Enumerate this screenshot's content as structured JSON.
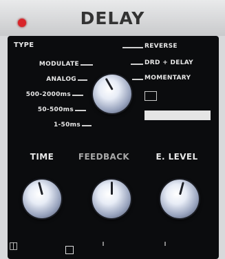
{
  "header": {
    "title": "DELAY"
  },
  "type_section": {
    "heading": "TYPE",
    "left_options": [
      "MODULATE",
      "ANALOG",
      "500-2000ms",
      "50-500ms",
      "1-50ms"
    ],
    "right_options": [
      "REVERSE",
      "DRD + DELAY",
      "MOMENTARY"
    ],
    "buttons": [
      "",
      ""
    ]
  },
  "params": [
    {
      "label": "TIME",
      "value": 0.45
    },
    {
      "label": "FEEDBACK",
      "value": 0.5
    },
    {
      "label": "E. LEVEL",
      "value": 0.55
    }
  ],
  "bottom": {
    "left_icon": "input-icon",
    "mid_icon": "jack-icon"
  }
}
